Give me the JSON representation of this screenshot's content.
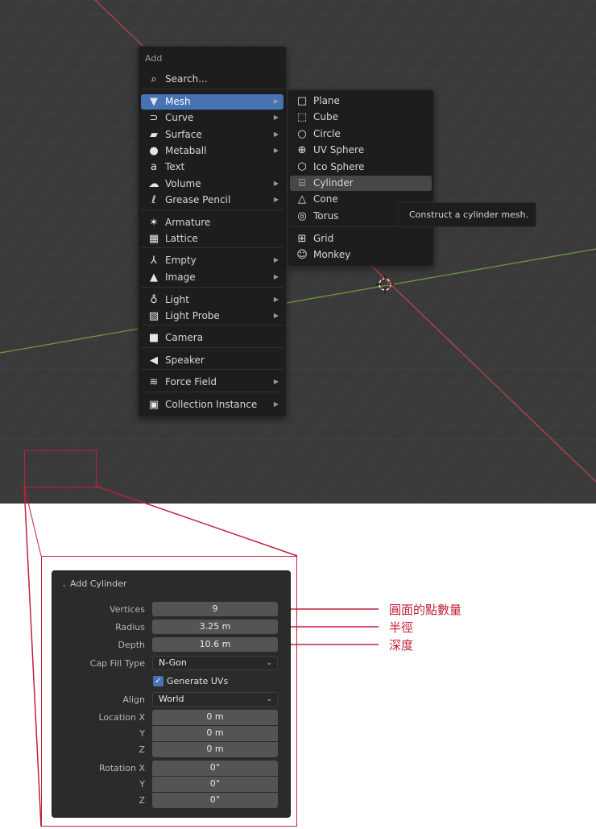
{
  "add_menu": {
    "title": "Add",
    "items": [
      {
        "label": "Search...",
        "icon": "search-icon",
        "glyph": "⌕",
        "submenu": false
      },
      {
        "label": "Mesh",
        "icon": "mesh-icon",
        "glyph": "▼",
        "submenu": true
      },
      {
        "label": "Curve",
        "icon": "curve-icon",
        "glyph": "⊃",
        "submenu": true
      },
      {
        "label": "Surface",
        "icon": "surface-icon",
        "glyph": "▰",
        "submenu": true
      },
      {
        "label": "Metaball",
        "icon": "metaball-icon",
        "glyph": "●",
        "submenu": true
      },
      {
        "label": "Text",
        "icon": "text-icon",
        "glyph": "a",
        "submenu": false
      },
      {
        "label": "Volume",
        "icon": "volume-icon",
        "glyph": "☁",
        "submenu": true
      },
      {
        "label": "Grease Pencil",
        "icon": "grease-pencil-icon",
        "glyph": "ℓ",
        "submenu": true
      },
      {
        "label": "Armature",
        "icon": "armature-icon",
        "glyph": "✶",
        "submenu": false
      },
      {
        "label": "Lattice",
        "icon": "lattice-icon",
        "glyph": "▦",
        "submenu": false
      },
      {
        "label": "Empty",
        "icon": "empty-icon",
        "glyph": "⅄",
        "submenu": true
      },
      {
        "label": "Image",
        "icon": "image-icon",
        "glyph": "▲",
        "submenu": true
      },
      {
        "label": "Light",
        "icon": "light-icon",
        "glyph": "♁",
        "submenu": true
      },
      {
        "label": "Light Probe",
        "icon": "light-probe-icon",
        "glyph": "▨",
        "submenu": true
      },
      {
        "label": "Camera",
        "icon": "camera-icon",
        "glyph": "■",
        "submenu": false
      },
      {
        "label": "Speaker",
        "icon": "speaker-icon",
        "glyph": "◀",
        "submenu": false
      },
      {
        "label": "Force Field",
        "icon": "force-field-icon",
        "glyph": "≋",
        "submenu": true
      },
      {
        "label": "Collection Instance",
        "icon": "collection-instance-icon",
        "glyph": "▣",
        "submenu": true
      }
    ],
    "active": "Mesh"
  },
  "mesh_submenu": {
    "items": [
      {
        "label": "Plane",
        "icon": "plane-icon",
        "glyph": "□"
      },
      {
        "label": "Cube",
        "icon": "cube-icon",
        "glyph": "⬚"
      },
      {
        "label": "Circle",
        "icon": "circle-icon",
        "glyph": "○"
      },
      {
        "label": "UV Sphere",
        "icon": "uv-sphere-icon",
        "glyph": "⊕"
      },
      {
        "label": "Ico Sphere",
        "icon": "ico-sphere-icon",
        "glyph": "⬡"
      },
      {
        "label": "Cylinder",
        "icon": "cylinder-icon",
        "glyph": "⌸"
      },
      {
        "label": "Cone",
        "icon": "cone-icon",
        "glyph": "△"
      },
      {
        "label": "Torus",
        "icon": "torus-icon",
        "glyph": "◎"
      },
      {
        "label": "Grid",
        "icon": "grid-icon",
        "glyph": "⊞"
      },
      {
        "label": "Monkey",
        "icon": "monkey-icon",
        "glyph": "☺"
      }
    ],
    "hovered": "Cylinder"
  },
  "tooltip": {
    "text": "Construct a cylinder mesh."
  },
  "operator_panel": {
    "title": "Add Cylinder",
    "vertices_label": "Vertices",
    "vertices_value": "9",
    "radius_label": "Radius",
    "radius_value": "3.25 m",
    "depth_label": "Depth",
    "depth_value": "10.6 m",
    "cap_fill_label": "Cap Fill Type",
    "cap_fill_value": "N-Gon",
    "generate_uvs_label": "Generate UVs",
    "generate_uvs_checked": true,
    "align_label": "Align",
    "align_value": "World",
    "location_x_label": "Location X",
    "location_x": "0 m",
    "location_y_label": "Y",
    "location_y": "0 m",
    "location_z_label": "Z",
    "location_z": "0 m",
    "rotation_x_label": "Rotation X",
    "rotation_x": "0°",
    "rotation_y_label": "Y",
    "rotation_y": "0°",
    "rotation_z_label": "Z",
    "rotation_z": "0°"
  },
  "annotations": {
    "vertices": "圓面的點數量",
    "radius": "半徑",
    "depth": "深度"
  },
  "colors": {
    "accent": "#4772b3",
    "annotation": "#c1203a",
    "x_axis": "#b8444f",
    "y_axis": "#6f9a3a"
  }
}
